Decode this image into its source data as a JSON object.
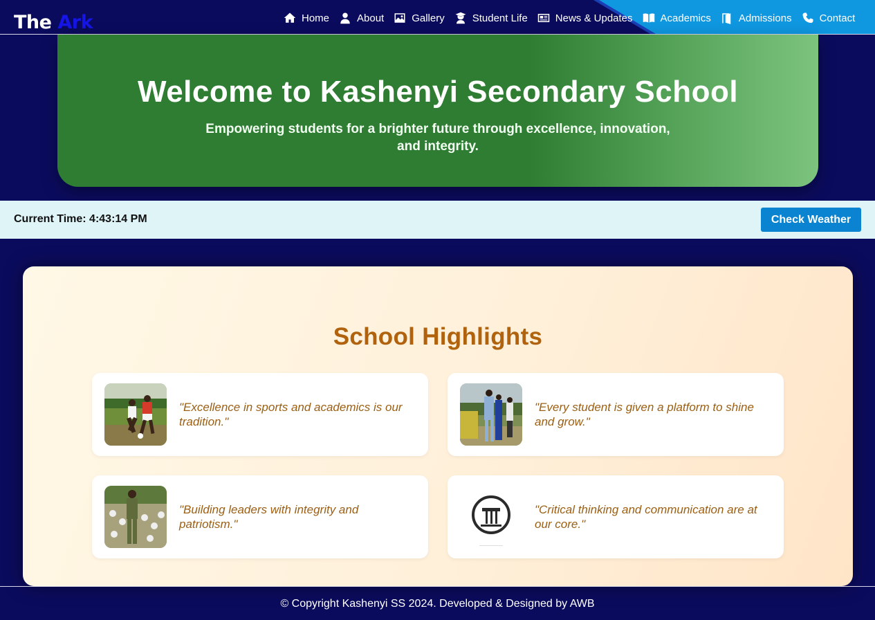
{
  "colors": {
    "page_bg": "#0b0b5e",
    "nav_accent": "#0f97e0",
    "hero_green": "#2e7d32",
    "hero_light_green": "#7cc47e",
    "time_bar_bg": "#dff4f7",
    "button_blue": "#0a84d0",
    "highlight_heading": "#b0620c",
    "quote_text": "#9b5f14"
  },
  "logo": {
    "text_main": "The",
    "text_accent": "Ark"
  },
  "nav": {
    "items": [
      {
        "label": "Home",
        "icon": "home-icon"
      },
      {
        "label": "About",
        "icon": "user-icon"
      },
      {
        "label": "Gallery",
        "icon": "image-icon"
      },
      {
        "label": "Student Life",
        "icon": "graduate-icon"
      },
      {
        "label": "News & Updates",
        "icon": "newspaper-icon"
      },
      {
        "label": "Academics",
        "icon": "book-icon"
      },
      {
        "label": "Admissions",
        "icon": "door-icon"
      },
      {
        "label": "Contact",
        "icon": "phone-icon"
      }
    ]
  },
  "hero": {
    "title": "Welcome to Kashenyi Secondary School",
    "subtitle": "Empowering students for a brighter future through excellence, innovation, and integrity."
  },
  "time_bar": {
    "current_time": "Current Time: 4:43:14 PM",
    "weather_button": "Check Weather"
  },
  "highlights": {
    "heading": "School Highlights",
    "cards": [
      {
        "quote": "\"Excellence in sports and academics is our tradition.\"",
        "image": "football-photo"
      },
      {
        "quote": "\"Every student is given a platform to shine and grow.\"",
        "image": "students-walking-photo"
      },
      {
        "quote": "\"Building leaders with integrity and patriotism.\"",
        "image": "cadet-parade-photo"
      },
      {
        "quote": "\"Critical thinking and communication are at our core.\"",
        "image": "school-emblem"
      }
    ]
  },
  "footer": {
    "text": "© Copyright Kashenyi SS 2024. Developed & Designed by AWB"
  }
}
